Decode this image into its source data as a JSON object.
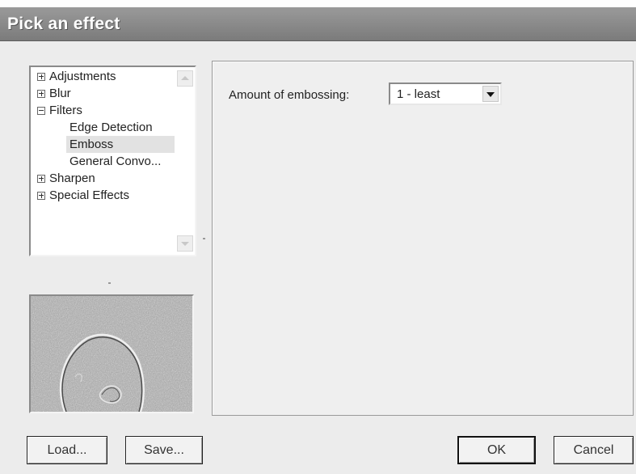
{
  "window": {
    "title": "Pick an effect"
  },
  "tree": {
    "items": [
      {
        "label": "Adjustments",
        "expander": "plus"
      },
      {
        "label": "Blur",
        "expander": "plus"
      },
      {
        "label": "Filters",
        "expander": "minus"
      },
      {
        "label": "Edge Detection",
        "expander": ""
      },
      {
        "label": "Emboss",
        "expander": "",
        "selected": true
      },
      {
        "label": "General Convo...",
        "expander": ""
      },
      {
        "label": "Sharpen",
        "expander": "plus"
      },
      {
        "label": "Special Effects",
        "expander": "plus"
      }
    ]
  },
  "settings": {
    "amount_label": "Amount of embossing:",
    "amount_value": "1 - least"
  },
  "buttons": {
    "load": "Load...",
    "save": "Save...",
    "ok": "OK",
    "cancel": "Cancel"
  },
  "icons": {
    "expand": "plus-box-icon",
    "collapse": "minus-box-icon",
    "scroll_up": "scroll-up-arrow-icon",
    "scroll_down": "scroll-down-arrow-icon",
    "dropdown": "chevron-down-icon"
  },
  "colors": {
    "titlebar": "#8a8a8a",
    "dialog_background": "#ececec",
    "selection": "#e2e2e2"
  }
}
